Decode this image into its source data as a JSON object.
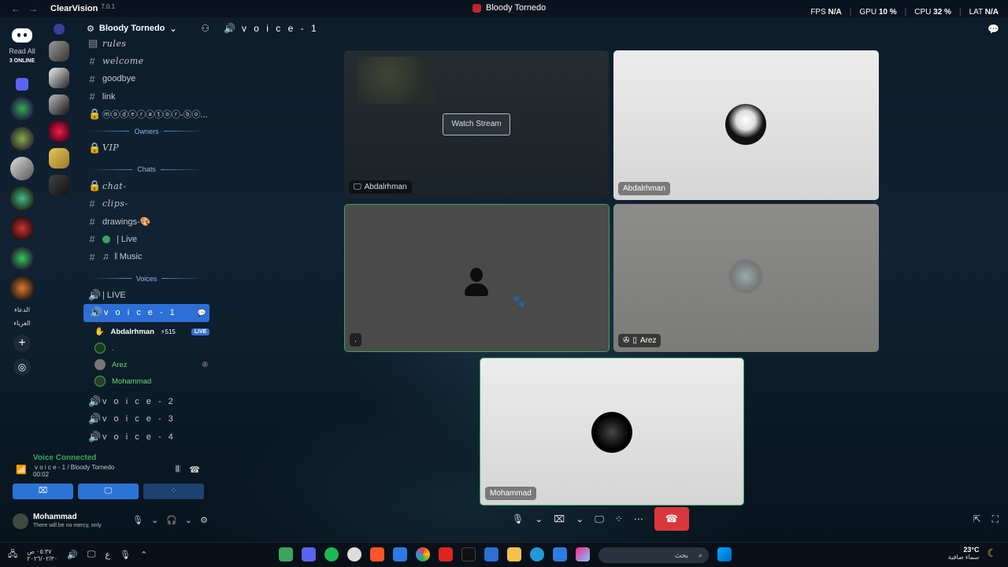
{
  "titlebar": {
    "app_name": "ClearVision",
    "version": "7.0.1",
    "server_title": "Bloody Tornedo",
    "stats": {
      "fps_label": "FPS",
      "fps": "N/A",
      "gpu_label": "GPU",
      "gpu": "10 %",
      "cpu_label": "CPU",
      "cpu": "32 %",
      "lat_label": "LAT",
      "lat": "N/A"
    }
  },
  "rail": {
    "read_all": "Read All",
    "online": "3 ONLINE",
    "text_server_1": "الدعاء",
    "text_server_2": "الغرباء"
  },
  "guild": {
    "name": "Bloody Tornedo"
  },
  "channels": [
    {
      "name": "rules"
    },
    {
      "name": "welcome"
    },
    {
      "name": "goodbye"
    },
    {
      "name": "link"
    },
    {
      "name": "ⓜⓞⓓⓔⓡⓐⓣⓞⓡ-ⓑⓞ..."
    }
  ],
  "categories": {
    "owners": "Owners",
    "chats": "Chats",
    "voices": "Voices"
  },
  "vip": "VIP",
  "chat_channels": [
    {
      "name": "chat-"
    },
    {
      "name": "clips-"
    },
    {
      "name": "drawings-🎨"
    },
    {
      "name": "| Live"
    },
    {
      "name": "𝄃 Music"
    }
  ],
  "voice_channels": {
    "live": "| LIVE",
    "active": "v o i c e - 1",
    "v2": "v o i c e - 2",
    "v3": "v o i c e - 3",
    "v4": "v o i c e - 4"
  },
  "members": [
    {
      "name": "Abdalrhman",
      "extra": "⚡515",
      "badge": "LIVE"
    },
    {
      "name": "."
    },
    {
      "name": "Arez"
    },
    {
      "name": "Mohammad"
    }
  ],
  "voice_panel": {
    "status": "Voice Connected",
    "channel": "v o i c e - 1 / Bloody Tornedo",
    "timer": "00:02"
  },
  "user": {
    "name": "Mohammad",
    "status": "There will be no mercy, only"
  },
  "main": {
    "channel_title": "v o i c e - 1",
    "watch_stream": "Watch Stream",
    "tiles": {
      "stream_name": "Abdalrhman",
      "cam_name": "Abdalrhman",
      "dot_name": ".",
      "arez_name": "Arez",
      "mohammad_name": "Mohammad"
    }
  },
  "taskbar": {
    "time": "٠٥:٣٧ ص",
    "date": "٢٠٢٦/٠٢/٣٠",
    "lang": "ع",
    "search_placeholder": "بحث",
    "temp": "23°C",
    "weather": "سماء صافية"
  },
  "colors": {
    "accent": "#2d6fd6",
    "green": "#3ba55d",
    "hangup": "#da373c"
  }
}
